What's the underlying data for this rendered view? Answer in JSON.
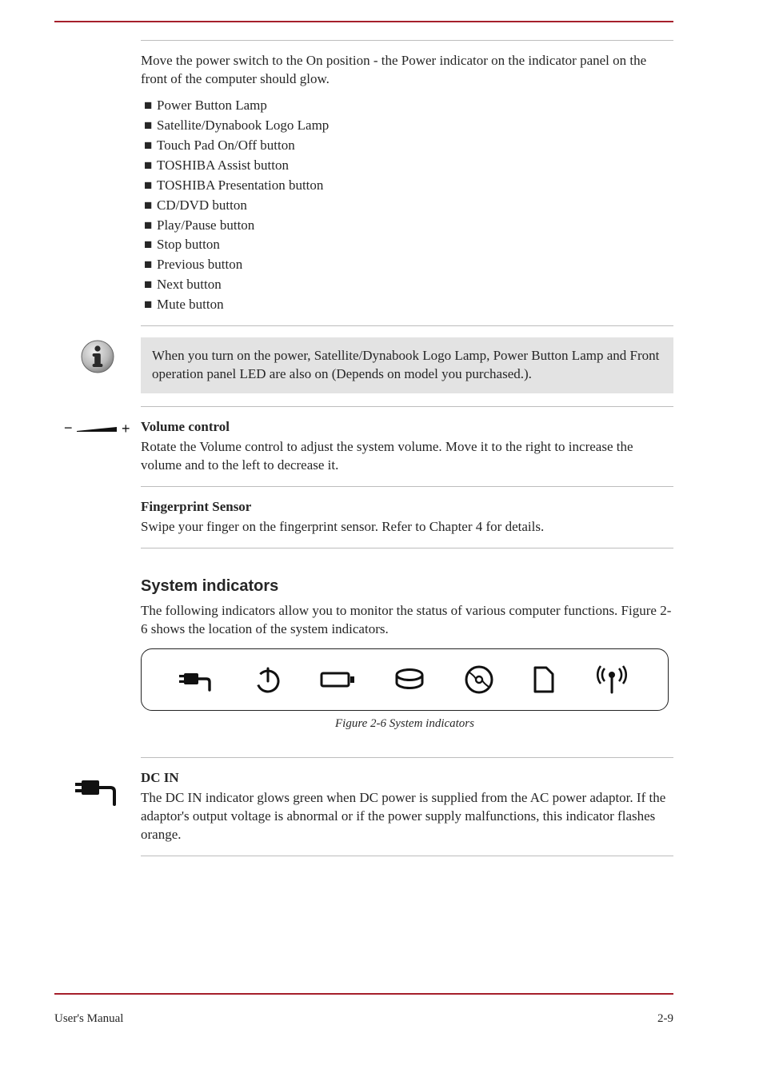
{
  "header": {
    "topRuleColor": "#a61f2b"
  },
  "intro": {
    "paragraph1": "Move the power switch to the On position - the Power indicator on the indicator panel on the front of the computer should glow.",
    "listItems": [
      "Power Button Lamp",
      "Satellite/Dynabook Logo Lamp",
      "Touch Pad On/Off button",
      "TOSHIBA Assist button",
      "TOSHIBA Presentation button",
      "CD/DVD button",
      "Play/Pause button",
      "Stop button",
      "Previous button",
      "Next button",
      "Mute button"
    ],
    "note": "When you turn on the power, Satellite/Dynabook Logo Lamp, Power Button Lamp and Front operation panel LED are also on (Depends on model you purchased.)."
  },
  "volume": {
    "term": "Volume control",
    "body": "Rotate the Volume control to adjust the system volume. Move it to the right to increase the volume and to the left to decrease it."
  },
  "fingerprint": {
    "term": "Fingerprint Sensor",
    "body": "Swipe your finger on the fingerprint sensor. Refer to Chapter 4 for details."
  },
  "indicators": {
    "heading": "System indicators",
    "body": "The following indicators allow you to monitor the status of various computer functions. Figure 2-6 shows the location of the system indicators.",
    "caption": "Figure 2-6 System indicators"
  },
  "dcin": {
    "term": "DC IN",
    "body": "The DC IN indicator glows green when DC power is supplied from the AC power adaptor. If the adaptor's output voltage is abnormal or if the power supply malfunctions, this indicator flashes orange."
  },
  "footer": {
    "left": "User's Manual",
    "right": "2-9"
  }
}
